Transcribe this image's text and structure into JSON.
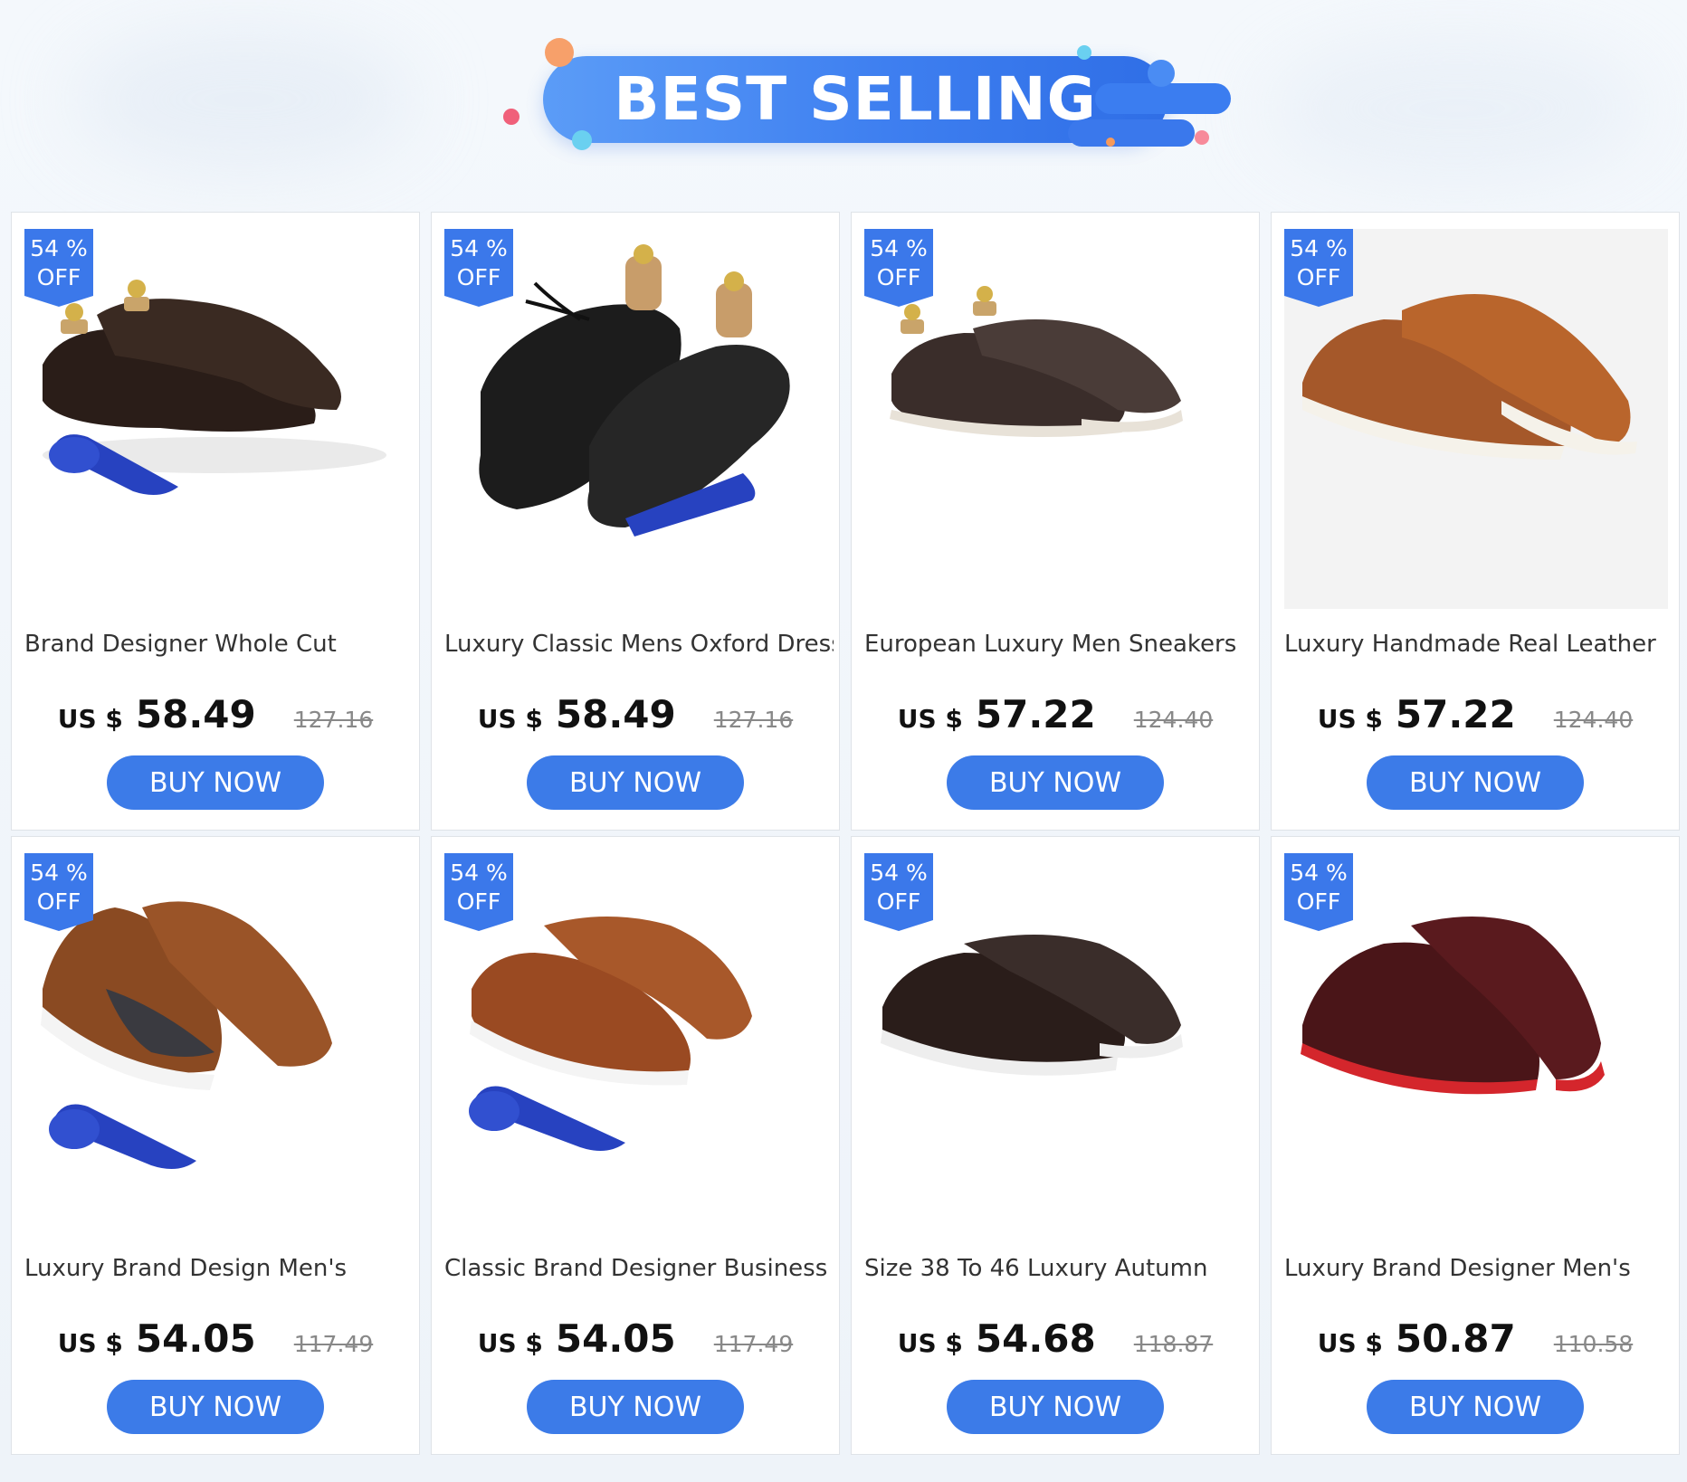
{
  "banner": {
    "title": "BEST SELLING"
  },
  "colors": {
    "accent": "#3c7be8",
    "badge": "#3b78ea",
    "text": "#333333"
  },
  "products": [
    {
      "discount": "54 %",
      "off": "OFF",
      "title": "Brand Designer Whole Cut",
      "currency": "US $",
      "price": "58.49",
      "old_price": "127.16",
      "button": "BUY NOW",
      "image": "dark-brown-oxford-shoes-with-blue-tie"
    },
    {
      "discount": "54 %",
      "off": "OFF",
      "title": "Luxury Classic Mens Oxford Dress",
      "currency": "US $",
      "price": "58.49",
      "old_price": "127.16",
      "button": "BUY NOW",
      "image": "black-brogue-oxford-shoes-with-blue-tie"
    },
    {
      "discount": "54 %",
      "off": "OFF",
      "title": "European Luxury Men Sneakers",
      "currency": "US $",
      "price": "57.22",
      "old_price": "124.40",
      "button": "BUY NOW",
      "image": "monk-strap-sneakers"
    },
    {
      "discount": "54 %",
      "off": "OFF",
      "title": "Luxury Handmade Real Leather",
      "currency": "US $",
      "price": "57.22",
      "old_price": "124.40",
      "button": "BUY NOW",
      "image": "tan-leather-sneakers"
    },
    {
      "discount": "54 %",
      "off": "OFF",
      "title": "Luxury Brand Design Men's",
      "currency": "US $",
      "price": "54.05",
      "old_price": "117.49",
      "button": "BUY NOW",
      "image": "brown-suede-sneakers-with-blue-tie"
    },
    {
      "discount": "54 %",
      "off": "OFF",
      "title": "Classic Brand Designer Business",
      "currency": "US $",
      "price": "54.05",
      "old_price": "117.49",
      "button": "BUY NOW",
      "image": "cognac-leather-sneakers-with-blue-tie"
    },
    {
      "discount": "54 %",
      "off": "OFF",
      "title": "Size 38 To 46 Luxury Autumn",
      "currency": "US $",
      "price": "54.68",
      "old_price": "118.87",
      "button": "BUY NOW",
      "image": "woven-leather-sneakers"
    },
    {
      "discount": "54 %",
      "off": "OFF",
      "title": "Luxury Brand Designer Men's",
      "currency": "US $",
      "price": "50.87",
      "old_price": "110.58",
      "button": "BUY NOW",
      "image": "burgundy-leather-sneakers"
    }
  ]
}
